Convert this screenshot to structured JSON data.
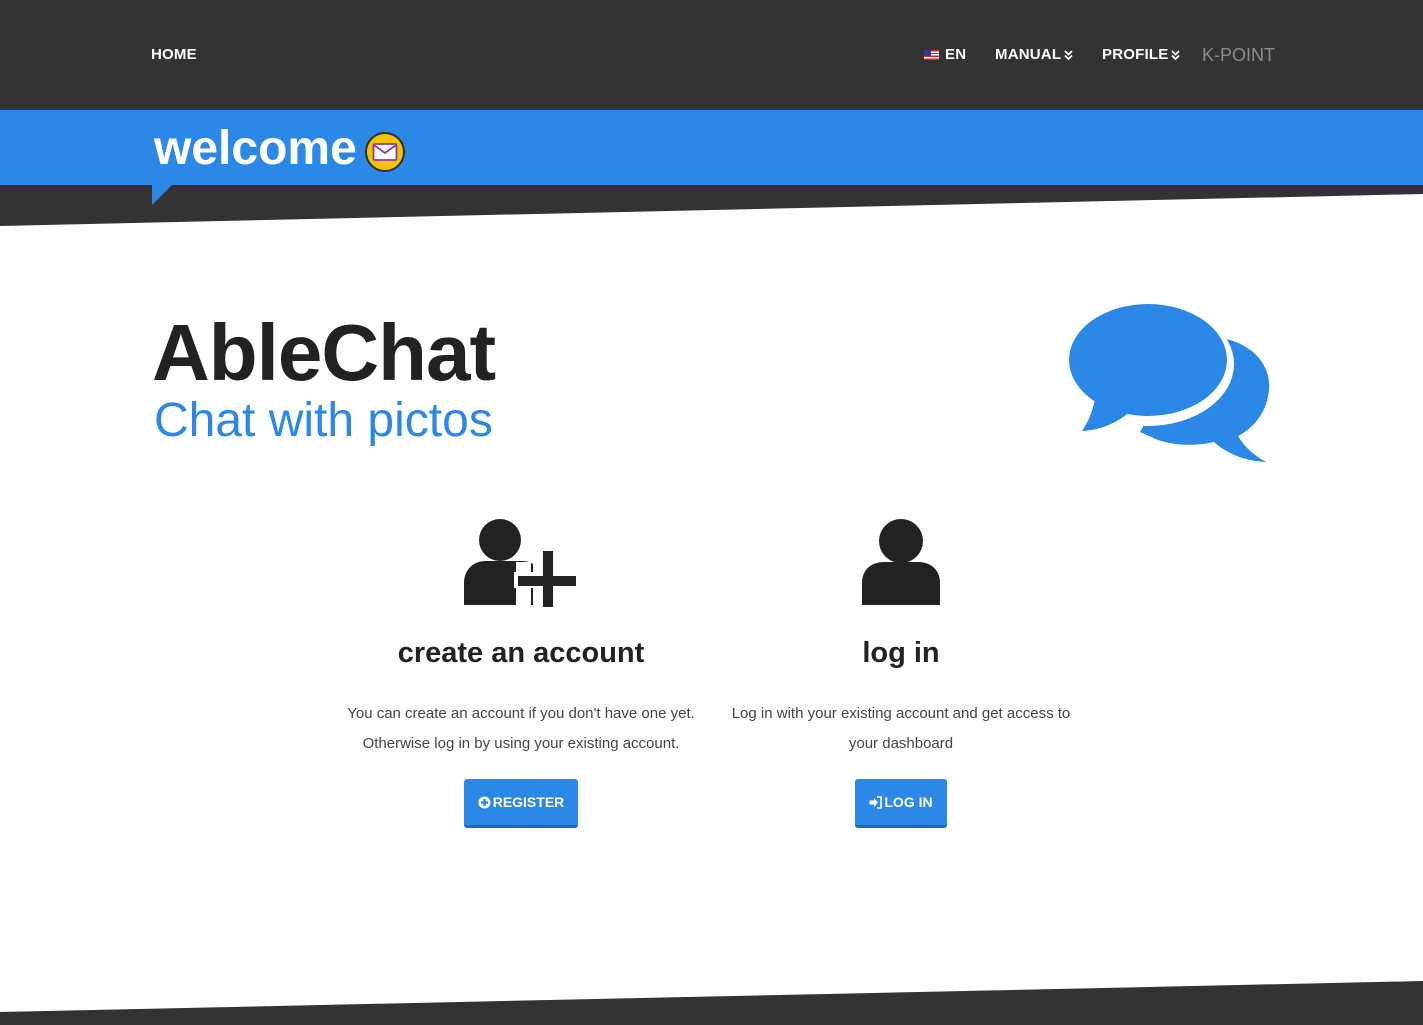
{
  "nav": {
    "home": "HOME",
    "language": "EN",
    "manual": "MANUAL",
    "profile": "PROFILE",
    "brand": "K-POINT"
  },
  "banner": {
    "title": "welcome",
    "icon": "mail-icon"
  },
  "hero": {
    "title": "AbleChat",
    "subtitle": "Chat with pictos",
    "icon": "chat-bubbles-icon"
  },
  "register": {
    "icon": "user-plus-icon",
    "heading": "create an account",
    "text": "You can create an account if you don't have one yet. Otherwise log in by using your existing account.",
    "button": "REGISTER",
    "button_icon": "plus-circle-icon"
  },
  "login": {
    "icon": "user-icon",
    "heading": "log in",
    "text": "Log in with your existing account and get access to your dashboard",
    "button": "LOG IN",
    "button_icon": "sign-in-icon"
  },
  "colors": {
    "accent": "#2b88e6",
    "dark": "#333333",
    "text": "#222222"
  }
}
